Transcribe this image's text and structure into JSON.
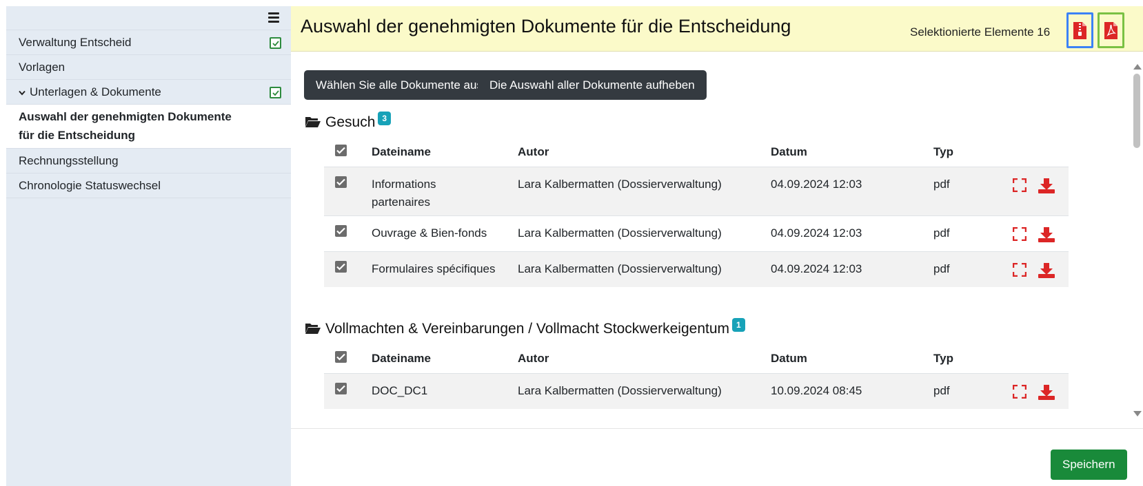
{
  "sidebar": {
    "items": [
      {
        "label": "Verwaltung Entscheid",
        "checked": true
      },
      {
        "label": "Vorlagen"
      },
      {
        "label": "Unterlagen & Dokumente",
        "expanded": true,
        "checked": true
      },
      {
        "label": "Auswahl der genehmigten Dokumente für die Entscheidung",
        "active": true
      },
      {
        "label": "Rechnungsstellung"
      },
      {
        "label": "Chronologie Statuswechsel"
      }
    ]
  },
  "header": {
    "title": "Auswahl der genehmigten Dokumente für die Entscheidung",
    "selected_label": "Selektionierte Elemente 16",
    "zip_icon": "zip-file-icon",
    "pdf_icon": "pdf-file-icon"
  },
  "toolbar": {
    "select_all": "Wählen Sie alle Dokumente aus",
    "deselect_all": "Die Auswahl aller Dokumente aufheben"
  },
  "columns": {
    "name": "Dateiname",
    "author": "Autor",
    "date": "Datum",
    "type": "Typ"
  },
  "sections": [
    {
      "title": "Gesuch",
      "count": "3",
      "rows": [
        {
          "name": "Informations partenaires",
          "author": "Lara Kalbermatten (Dossierverwaltung)",
          "date": "04.09.2024 12:03",
          "type": "pdf",
          "checked": true
        },
        {
          "name": "Ouvrage & Bien-fonds",
          "author": "Lara Kalbermatten (Dossierverwaltung)",
          "date": "04.09.2024 12:03",
          "type": "pdf",
          "checked": true
        },
        {
          "name": "Formulaires spécifiques",
          "author": "Lara Kalbermatten (Dossierverwaltung)",
          "date": "04.09.2024 12:03",
          "type": "pdf",
          "checked": true
        }
      ]
    },
    {
      "title": "Vollmachten & Vereinbarungen / Vollmacht Stockwerkeigentum",
      "count": "1",
      "rows": [
        {
          "name": "DOC_DC1",
          "author": "Lara Kalbermatten (Dossierverwaltung)",
          "date": "10.09.2024 08:45",
          "type": "pdf",
          "checked": true
        }
      ]
    }
  ],
  "footer": {
    "save_label": "Speichern"
  },
  "colors": {
    "sidebar_bg": "#e4ebf3",
    "header_bg": "#fbfac9",
    "badge": "#17a2b8",
    "save": "#198a3a",
    "icon_red": "#dc2626"
  }
}
